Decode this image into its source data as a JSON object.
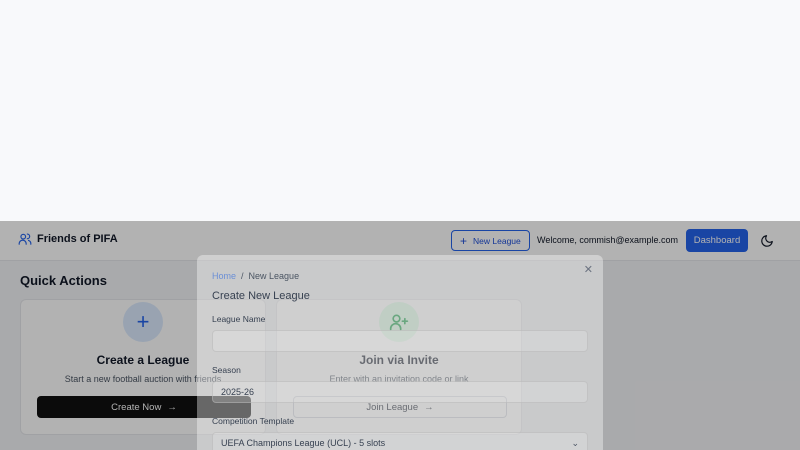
{
  "header": {
    "brand": "Friends of PIFA",
    "brand_icon": "users-icon",
    "new_league_label": "New League",
    "welcome_text": "Welcome, commish@example.com",
    "dashboard_label": "Dashboard",
    "theme_icon": "moon-icon"
  },
  "quick_actions": {
    "title": "Quick Actions",
    "create": {
      "icon": "plus-icon",
      "title": "Create a League",
      "description": "Start a new football auction with friends",
      "button": "Create Now"
    },
    "join": {
      "icon": "user-plus-icon",
      "title": "Join via Invite",
      "description": "Enter with an invitation code or link",
      "button": "Join League"
    }
  },
  "modal": {
    "breadcrumb": {
      "home": "Home",
      "separator": "/",
      "current": "New League"
    },
    "title": "Create New League",
    "close_icon": "close-icon",
    "fields": {
      "league_name": {
        "label": "League Name",
        "value": ""
      },
      "season": {
        "label": "Season",
        "value": "2025-26"
      },
      "competition_template": {
        "label": "Competition Template",
        "value": "UEFA Champions League (UCL) - 5 slots"
      }
    }
  },
  "colors": {
    "accent": "#2563eb",
    "success": "#16a34a",
    "dark_button": "#111111"
  }
}
